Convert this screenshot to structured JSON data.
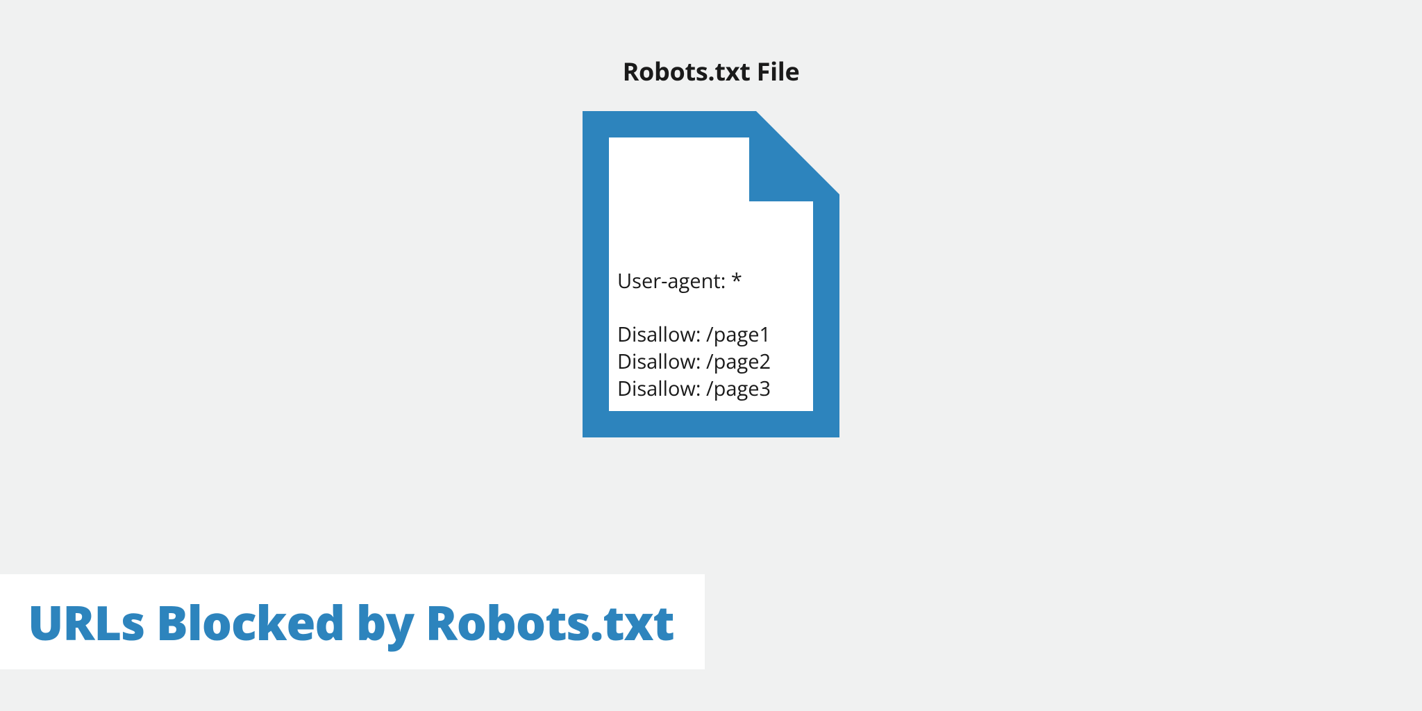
{
  "title": "Robots.txt File",
  "file": {
    "user_agent": "User-agent: *",
    "rules": [
      "Disallow: /page1",
      "Disallow: /page2",
      "Disallow: /page3"
    ]
  },
  "bottom_label": "URLs Blocked by Robots.txt",
  "colors": {
    "icon": "#2d84bd",
    "bg": "#f0f1f1"
  }
}
